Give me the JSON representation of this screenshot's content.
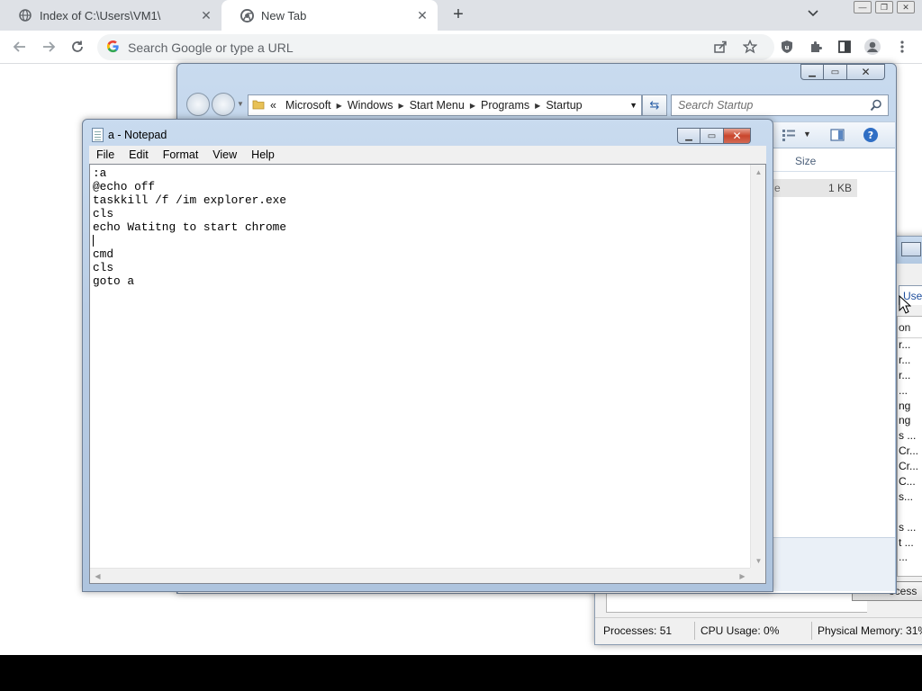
{
  "browser": {
    "tabs": [
      {
        "title": "Index of C:\\Users\\VM1\\",
        "active": false,
        "favicon": "globe-icon"
      },
      {
        "title": "New Tab",
        "active": true,
        "favicon": "chrome-icon"
      }
    ],
    "omnibox": {
      "placeholder": "Search Google or type a URL",
      "value": ""
    },
    "toolbar_icons": [
      "back-icon",
      "forward-icon",
      "reload-icon",
      "share-icon",
      "star-icon",
      "shield-extension-icon",
      "puzzle-icon",
      "side-panel-icon",
      "profile-icon",
      "menu-icon"
    ]
  },
  "explorer": {
    "breadcrumb": {
      "overflow": "«",
      "segments": [
        "Microsoft",
        "Windows",
        "Start Menu",
        "Programs",
        "Startup"
      ]
    },
    "search_placeholder": "Search Startup",
    "columns": {
      "size": "Size"
    },
    "rows": [
      {
        "type_fragment": "e",
        "size": "1 KB"
      }
    ]
  },
  "notepad": {
    "title": "a - Notepad",
    "menu": [
      "File",
      "Edit",
      "Format",
      "View",
      "Help"
    ],
    "lines": [
      ":a",
      "@echo off",
      "taskkill /f /im explorer.exe",
      "cls",
      "echo Watitng to start chrome",
      "",
      "cmd",
      "cls",
      "goto a"
    ],
    "caret_line": 5
  },
  "taskmgr": {
    "tab_label": "Users",
    "column_header": "on",
    "row_fragments": [
      "r...",
      "r...",
      "r...",
      "...",
      "ng",
      "ng",
      "s ...",
      "Cr...",
      "Cr...",
      "C...",
      "s...",
      "",
      "s ...",
      "t ...",
      "..."
    ],
    "end_button": "ocess",
    "status": {
      "processes": "Processes: 51",
      "cpu": "CPU Usage: 0%",
      "memory": "Physical Memory: 31%"
    }
  },
  "colors": {
    "chrome_tabstrip": "#dee1e6",
    "omnibox_bg": "#f1f3f4",
    "win7_frame": "#b9cde5",
    "close_red": "#c9452c"
  }
}
